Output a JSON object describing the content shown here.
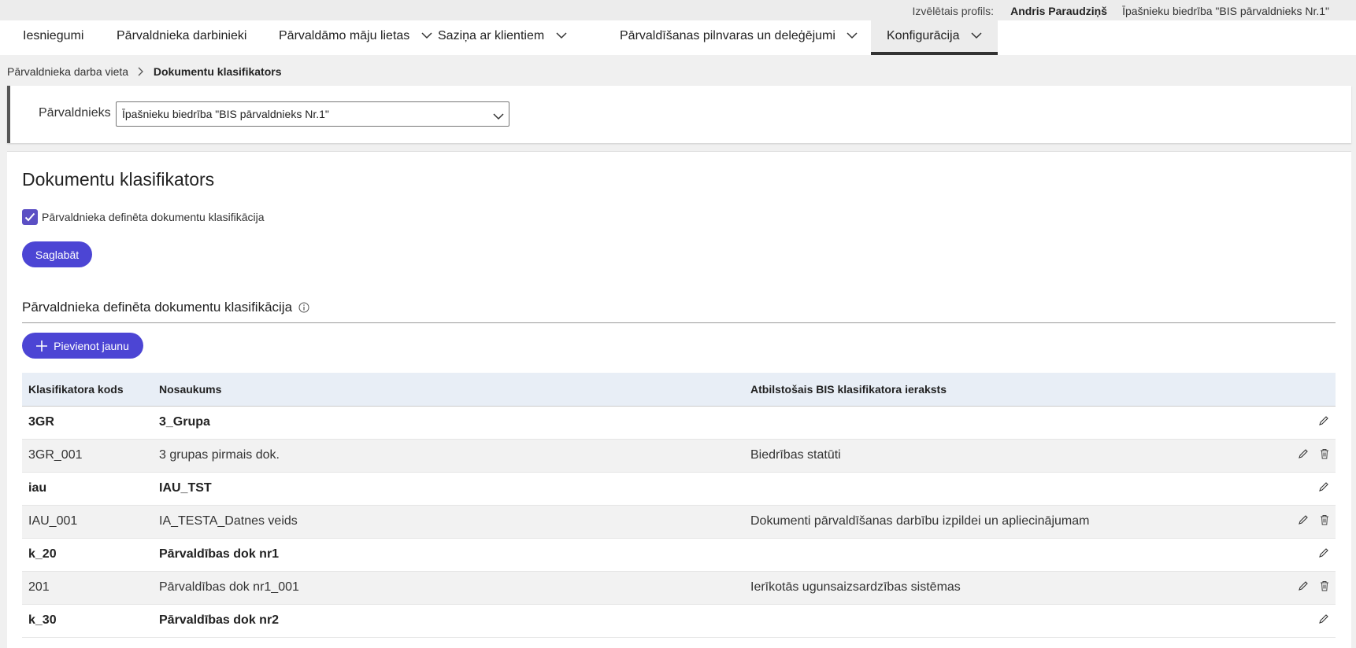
{
  "topbar": {
    "profile_label": "Izvēlētais profils:",
    "user_name": "Andris Paraudziņš",
    "organization": "Īpašnieku biedrība \"BIS pārvaldnieks Nr.1\""
  },
  "nav": {
    "items": [
      {
        "label": "Iesniegumi"
      },
      {
        "label": "Pārvaldnieka darbinieki"
      },
      {
        "label": "Pārvaldāmo māju lietas"
      },
      {
        "label": "Saziņa ar klientiem"
      },
      {
        "label": "Pārvaldīšanas pilnvaras un deleģējumi"
      },
      {
        "label": "Konfigurācija"
      }
    ]
  },
  "breadcrumb": {
    "parent": "Pārvaldnieka darba vieta",
    "current": "Dokumentu klasifikators"
  },
  "filter": {
    "label": "Pārvaldnieks",
    "selected": "Īpašnieku biedrība \"BIS pārvaldnieks Nr.1\""
  },
  "main": {
    "title": "Dokumentu klasifikators",
    "checkbox_label": "Pārvaldnieka definēta dokumentu klasifikācija",
    "checkbox_checked": true,
    "save_label": "Saglabāt",
    "section_title": "Pārvaldnieka definēta dokumentu klasifikācija",
    "add_label": "Pievienot jaunu"
  },
  "table": {
    "headers": {
      "code": "Klasifikatora kods",
      "name": "Nosaukums",
      "bis": "Atbilstošais BIS klasifikatora ieraksts"
    },
    "rows": [
      {
        "code": "3GR",
        "name": "3_Grupa",
        "bis": ""
      },
      {
        "code": "3GR_001",
        "name": "3 grupas pirmais dok.",
        "bis": "Biedrības statūti"
      },
      {
        "code": "iau",
        "name": "IAU_TST",
        "bis": ""
      },
      {
        "code": "IAU_001",
        "name": "IA_TESTA_Datnes veids",
        "bis": "Dokumenti pārvaldīšanas darbību izpildei un apliecinājumam"
      },
      {
        "code": "k_20",
        "name": "Pārvaldības dok nr1",
        "bis": ""
      },
      {
        "code": "201",
        "name": "Pārvaldības dok nr1_001",
        "bis": "Ierīkotās ugunsaizsardzības sistēmas"
      },
      {
        "code": "k_30",
        "name": "Pārvaldības dok nr2",
        "bis": ""
      }
    ]
  },
  "colors": {
    "primary": "#4c45d4",
    "header_row": "#e8eef6"
  }
}
